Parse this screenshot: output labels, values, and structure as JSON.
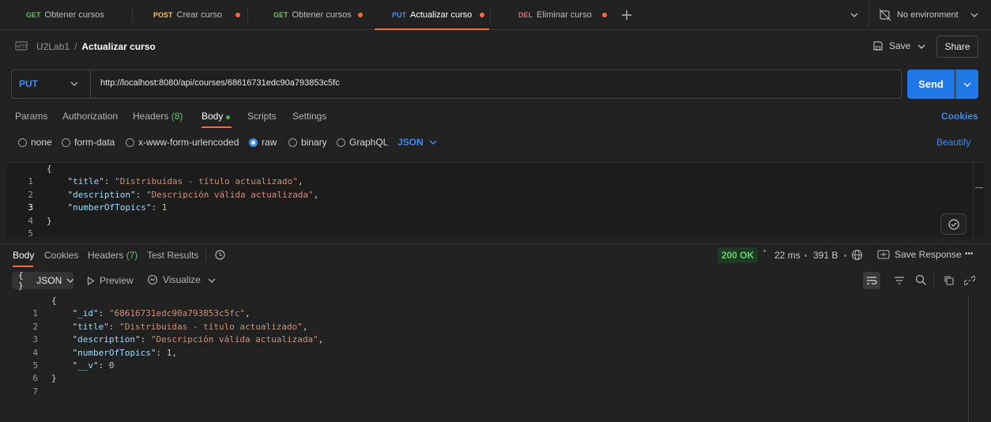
{
  "tabs": [
    {
      "method": "GET",
      "label": "Obtener cursos",
      "color": "#6bbe6b",
      "dirty": false
    },
    {
      "method": "POST",
      "label": "Crear curso",
      "color": "#f2c14e",
      "dirty": true
    },
    {
      "method": "GET",
      "label": "Obtener cursos",
      "color": "#6bbe6b",
      "dirty": true
    },
    {
      "method": "PUT",
      "label": "Actualizar curso",
      "color": "#3b8cf0",
      "dirty": true,
      "active": true
    },
    {
      "method": "DEL",
      "label": "Eliminar curso",
      "color": "#e26b6b",
      "dirty": true
    }
  ],
  "environment": "No environment",
  "breadcrumb": {
    "collection": "U2Lab1",
    "separator": "/",
    "request": "Actualizar curso"
  },
  "actions": {
    "save": "Save",
    "share": "Share"
  },
  "request": {
    "method": "PUT",
    "url": "http://localhost:8080/api/courses/68616731edc90a793853c5fc",
    "send": "Send"
  },
  "req_tabs": {
    "params": "Params",
    "authorization": "Authorization",
    "headers": "Headers",
    "headers_count": "(8)",
    "body": "Body",
    "scripts": "Scripts",
    "settings": "Settings",
    "cookies": "Cookies"
  },
  "body_types": {
    "none": "none",
    "form_data": "form-data",
    "urlencoded": "x-www-form-urlencoded",
    "raw": "raw",
    "binary": "binary",
    "graphql": "GraphQL",
    "format": "JSON",
    "beautify": "Beautify"
  },
  "request_body": {
    "line_numbers": [
      "1",
      "2",
      "3",
      "4",
      "5"
    ],
    "open": "{",
    "close": "}",
    "k1": "\"title\"",
    "v1": "\"Distribuidas - título actualizado\"",
    "k2": "\"description\"",
    "v2": "\"Descripción válida actualizada\"",
    "k3": "\"numberOfTopics\"",
    "v3": "1"
  },
  "resp_tabs": {
    "body": "Body",
    "cookies": "Cookies",
    "headers": "Headers",
    "headers_count": "(7)",
    "tests": "Test Results"
  },
  "response_meta": {
    "status": "200 OK",
    "time": "22 ms",
    "size": "391 B",
    "save": "Save Response",
    "more": "•••"
  },
  "resp_toolbar": {
    "format": "JSON",
    "format_icon": "{ }",
    "preview": "Preview",
    "visualize": "Visualize"
  },
  "response_body": {
    "line_numbers": [
      "1",
      "2",
      "3",
      "4",
      "5",
      "6",
      "7"
    ],
    "open": "{",
    "close": "}",
    "k1": "\"_id\"",
    "v1": "\"68616731edc90a793853c5fc\"",
    "k2": "\"title\"",
    "v2": "\"Distribuidas - título actualizado\"",
    "k3": "\"description\"",
    "v3": "\"Descripción válida actualizada\"",
    "k4": "\"numberOfTopics\"",
    "v4": "1",
    "k5": "\"__v\"",
    "v5": "0"
  },
  "colors": {
    "accent": "#f26b3a",
    "primary": "#3b8cf0",
    "status_ok": "#4caf50"
  }
}
